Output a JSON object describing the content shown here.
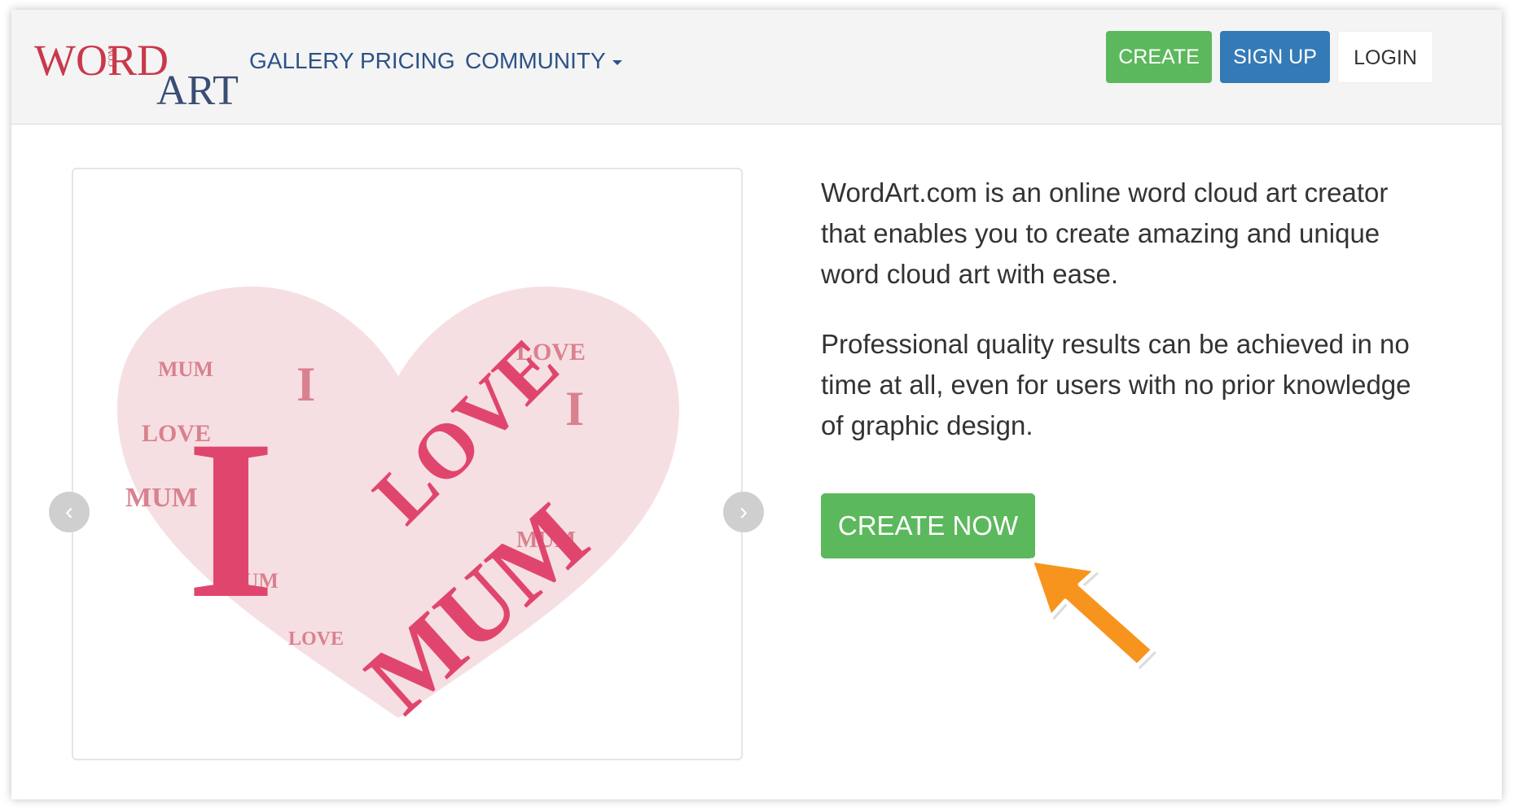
{
  "logo": {
    "text_word": "WORD",
    "text_art": "ART",
    "text_com": "COM"
  },
  "nav": {
    "gallery": "GALLERY",
    "pricing": "PRICING",
    "community": "COMMUNITY"
  },
  "buttons": {
    "create": "CREATE",
    "signup": "SIGN UP",
    "login": "LOGIN"
  },
  "carousel": {
    "heart_words": [
      "I",
      "LOVE",
      "MUM"
    ],
    "prev_glyph": "‹",
    "next_glyph": "›"
  },
  "main": {
    "description_1": "WordArt.com is an online word cloud art creator that enables you to create amazing and unique word cloud art with ease.",
    "description_2": "Professional quality results can be achieved in no time at all, even for users with no prior knowledge of graphic design.",
    "cta_label": "CREATE NOW"
  },
  "colors": {
    "primary_green": "#5cb85c",
    "primary_blue": "#337ab7",
    "nav_blue": "#2c5287",
    "logo_red": "#c9394b",
    "logo_navy": "#3a4d75",
    "heart_pink": "#e0466d",
    "heart_light": "#d9818e",
    "pointer_orange": "#f7941d"
  }
}
